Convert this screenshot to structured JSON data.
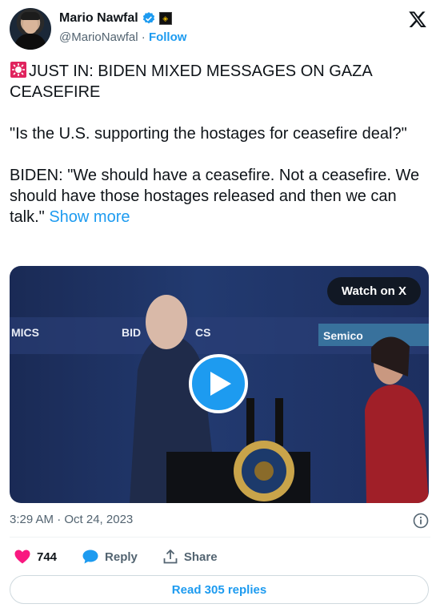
{
  "author": {
    "name": "Mario Nawfal",
    "handle": "@MarioNawfal",
    "separator": "·",
    "follow_label": "Follow"
  },
  "post": {
    "paragraphs": [
      "JUST IN: BIDEN MIXED MESSAGES ON GAZA CEASEFIRE",
      "\"Is the U.S. supporting the hostages for ceasefire deal?\"",
      "BIDEN: \"We should have a ceasefire. Not a ceasefire. We should have those hostages released and then we can talk.\""
    ],
    "show_more": "Show more",
    "lead_icon": "siren-icon"
  },
  "media": {
    "watch_label": "Watch on X",
    "background_signs": [
      "MICS",
      "BID",
      "CS",
      "Semico"
    ]
  },
  "meta": {
    "timestamp": "3:29 AM · Oct 24, 2023"
  },
  "actions": {
    "like_count": "744",
    "reply_label": "Reply",
    "share_label": "Share"
  },
  "read_replies": "Read 305 replies",
  "colors": {
    "accent": "#1d9bf0",
    "like": "#f91880",
    "muted": "#536471"
  }
}
